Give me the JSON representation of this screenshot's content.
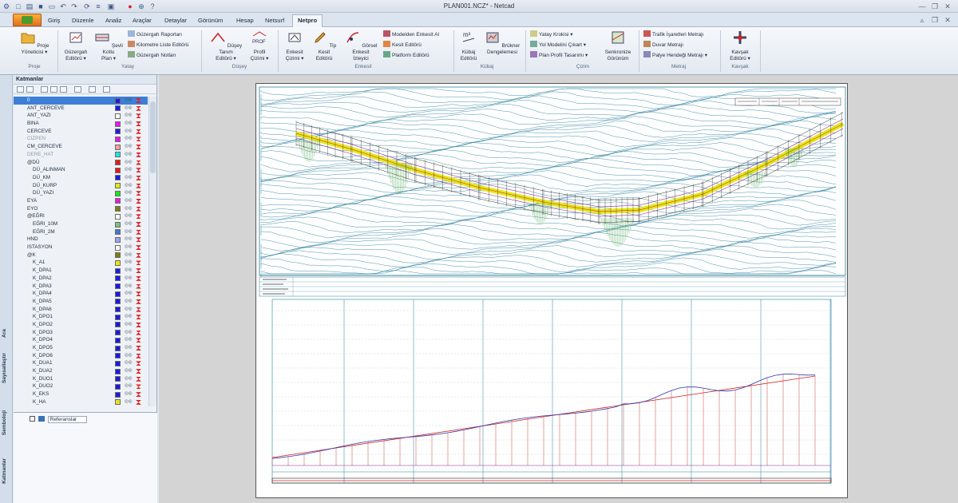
{
  "window": {
    "title": "PLAN001.NCZ* - Netcad"
  },
  "tabs": [
    "Giriş",
    "Düzenle",
    "Analiz",
    "Araçlar",
    "Detaylar",
    "Görünüm",
    "Hesap",
    "Netsurf",
    "Netpro"
  ],
  "active_tab": "Netpro",
  "ribbon": {
    "proje": {
      "group": "Proje",
      "button": "Proje\nYöneticisi ▾"
    },
    "yatay": {
      "group": "Yatay",
      "big": [
        "Güzergah\nEditörü ▾",
        "Şevli Kotlu\nPlan ▾"
      ],
      "small": [
        "Güzergah Raporları",
        "Kilometre Liste Editörü",
        "Güzergah Notları"
      ]
    },
    "duseY": {
      "group": "Düşey",
      "big": [
        "Düşey Tanım\nEditörü ▾",
        "Profil\nÇizimi ▾"
      ],
      "prof_icon_label": "PROF"
    },
    "enkesit": {
      "group": "Enkesit",
      "big": [
        "Enkesit\nÇizimi ▾",
        "Tip Kesit\nEditörü",
        "Görsel Enkesit\nİzleyici"
      ],
      "small": [
        "Modelden Enkesit Al",
        "Kesit Editörü",
        "Platform Editörü"
      ]
    },
    "kubaj": {
      "group": "Kübaj",
      "big": [
        "Kübaj\nEditörü",
        "Brükner\nDengelemesi"
      ],
      "m3_label": "m³"
    },
    "cizim": {
      "group": "Çizim",
      "small": [
        "Yatay Krokisi ▾",
        "Yol Modelini Çıkart ▾",
        "Plan Profil Tasarımı ▾"
      ],
      "big": [
        "Senkronize\nGörünüm"
      ]
    },
    "metraj": {
      "group": "Metraj",
      "small": [
        "Trafik İşaretleri Metrajı",
        "Duvar Metrajı",
        "Palye Hendeği Metrajı ▾"
      ]
    },
    "kavsak": {
      "group": "Kavşak",
      "big": [
        "Kavşak\nEditörü ▾"
      ]
    }
  },
  "side_tabs": [
    "Ara",
    "Sayısallaştır",
    "Semboloji",
    "Katmanlar"
  ],
  "layers_panel": {
    "header": "Katmanlar",
    "layers": [
      {
        "name": "0",
        "color": "#1a1ae6",
        "indent": 0,
        "selected": true
      },
      {
        "name": "ANT_CERCEVE",
        "color": "#1a1ae6",
        "indent": 0
      },
      {
        "name": "ANT_YAZI",
        "color": "#ffffff",
        "indent": 0
      },
      {
        "name": "BINA",
        "color": "#e61ae6",
        "indent": 0
      },
      {
        "name": "CERCEVE",
        "color": "#1a1ae6",
        "indent": 0
      },
      {
        "name": "CIZPEN",
        "color": "#e61ae6",
        "indent": 0,
        "dim": true
      },
      {
        "name": "CM_CERCEVE",
        "color": "#f0a0a0",
        "indent": 0
      },
      {
        "name": "DERE_HAT",
        "color": "#1ae6e6",
        "indent": 0,
        "dim": true
      },
      {
        "name": "@DÜ",
        "color": "#e61a1a",
        "indent": 0
      },
      {
        "name": "DÜ_ALINMAN",
        "color": "#e61a1a",
        "indent": 1
      },
      {
        "name": "DÜ_KM",
        "color": "#1a1ae6",
        "indent": 1
      },
      {
        "name": "DÜ_KURP",
        "color": "#e6e61a",
        "indent": 1
      },
      {
        "name": "DÜ_YAZI",
        "color": "#1ae61a",
        "indent": 1
      },
      {
        "name": "EYA",
        "color": "#e61ae6",
        "indent": 0
      },
      {
        "name": "EYO",
        "color": "#808000",
        "indent": 0
      },
      {
        "name": "@EĞRI",
        "color": "#ffffff",
        "indent": 0
      },
      {
        "name": "EĞRI_10M",
        "color": "#80c080",
        "indent": 1
      },
      {
        "name": "EĞRI_2M",
        "color": "#3a7ad0",
        "indent": 1
      },
      {
        "name": "HND",
        "color": "#a0a0f0",
        "indent": 0
      },
      {
        "name": "ISTASYON",
        "color": "#ffffff",
        "indent": 0
      },
      {
        "name": "@K",
        "color": "#808000",
        "indent": 0
      },
      {
        "name": "K_A1",
        "color": "#e6e61a",
        "indent": 1
      },
      {
        "name": "K_DPA1",
        "color": "#1a1ae6",
        "indent": 1
      },
      {
        "name": "K_DPA2",
        "color": "#1a1ae6",
        "indent": 1
      },
      {
        "name": "K_DPA3",
        "color": "#1a1ae6",
        "indent": 1
      },
      {
        "name": "K_DPA4",
        "color": "#1a1ae6",
        "indent": 1
      },
      {
        "name": "K_DPA5",
        "color": "#1a1ae6",
        "indent": 1
      },
      {
        "name": "K_DPA6",
        "color": "#1a1ae6",
        "indent": 1
      },
      {
        "name": "K_DPO1",
        "color": "#1a1ae6",
        "indent": 1
      },
      {
        "name": "K_DPO2",
        "color": "#1a1ae6",
        "indent": 1
      },
      {
        "name": "K_DPO3",
        "color": "#1a1ae6",
        "indent": 1
      },
      {
        "name": "K_DPO4",
        "color": "#1a1ae6",
        "indent": 1
      },
      {
        "name": "K_DPO5",
        "color": "#1a1ae6",
        "indent": 1
      },
      {
        "name": "K_DPO6",
        "color": "#1a1ae6",
        "indent": 1
      },
      {
        "name": "K_DUA1",
        "color": "#1a1ae6",
        "indent": 1
      },
      {
        "name": "K_DUA2",
        "color": "#1a1ae6",
        "indent": 1
      },
      {
        "name": "K_DUO1",
        "color": "#1a1ae6",
        "indent": 1
      },
      {
        "name": "K_DUO2",
        "color": "#1a1ae6",
        "indent": 1
      },
      {
        "name": "K_EKS",
        "color": "#1a1ae6",
        "indent": 1
      },
      {
        "name": "K_HA",
        "color": "#e6e61a",
        "indent": 1
      }
    ],
    "references_label": "Referanslar"
  },
  "drawing": {
    "route_color": "#e6e61a",
    "contour_color": "#2a7f9e",
    "terrain_profile_color": "#3333aa",
    "grade_line_color": "#cc2222"
  }
}
